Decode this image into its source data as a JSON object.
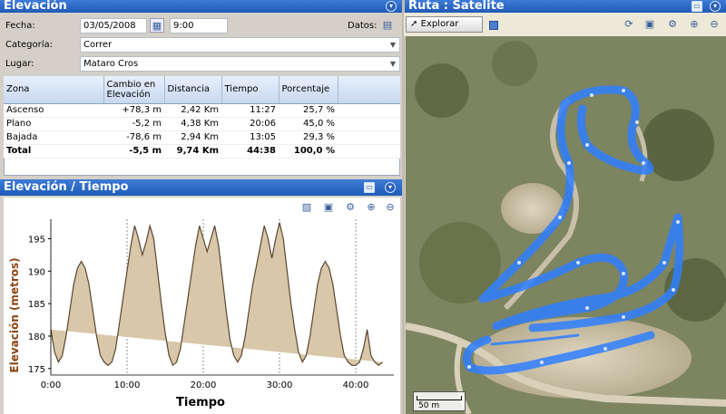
{
  "elevation_panel": {
    "title": "Elevación",
    "fecha_label": "Fecha:",
    "fecha_value": "03/05/2008",
    "hora_value": "9:00",
    "datos_label": "Datos:",
    "categoria_label": "Categoría:",
    "categoria_value": "Correr",
    "lugar_label": "Lugar:",
    "lugar_value": "Mataro Cros"
  },
  "zones_table": {
    "headers": [
      "Zona",
      "Cambio en Elevación",
      "Distancia",
      "Tiempo",
      "Porcentaje"
    ],
    "rows": [
      {
        "zona": "Ascenso",
        "cambio": "+78,3 m",
        "distancia": "2,42 Km",
        "tiempo": "11:27",
        "porcentaje": "25,7 %"
      },
      {
        "zona": "Plano",
        "cambio": "-5,2 m",
        "distancia": "4,38 Km",
        "tiempo": "20:06",
        "porcentaje": "45,0 %"
      },
      {
        "zona": "Bajada",
        "cambio": "-78,6 m",
        "distancia": "2,94 Km",
        "tiempo": "13:05",
        "porcentaje": "29,3 %"
      }
    ],
    "total": {
      "zona": "Total",
      "cambio": "-5,5 m",
      "distancia": "9,74 Km",
      "tiempo": "44:38",
      "porcentaje": "100,0 %"
    }
  },
  "chart_panel": {
    "title": "Elevación / Tiempo"
  },
  "route_panel": {
    "title": "Ruta : Satelite",
    "explore_label": "Explorar",
    "scale_label": "50 m"
  },
  "colors": {
    "title_bar": "#1f5bb8",
    "elevation_fill": "#d8c7a8",
    "elevation_line": "#5a4630",
    "axis_label": "#8b4513",
    "route": "#2f7fff"
  },
  "chart_data": {
    "type": "area",
    "xlabel": "Tiempo",
    "ylabel": "Elevación (metros)",
    "xlim": [
      0,
      45
    ],
    "ylim": [
      174,
      198
    ],
    "x_ticks": [
      "0:00",
      "10:00",
      "20:00",
      "30:00",
      "40:00"
    ],
    "x_tick_values": [
      0,
      10,
      20,
      30,
      40
    ],
    "y_ticks": [
      175,
      180,
      185,
      190,
      195
    ],
    "grid": "vertical-dashed",
    "x": [
      0,
      0.5,
      1,
      1.5,
      2,
      2.5,
      3,
      3.5,
      4,
      4.5,
      5,
      5.5,
      6,
      6.5,
      7,
      7.5,
      8,
      8.5,
      9,
      9.5,
      10,
      10.5,
      11,
      11.5,
      12,
      12.5,
      13,
      13.5,
      14,
      14.5,
      15,
      15.5,
      16,
      16.5,
      17,
      17.5,
      18,
      18.5,
      19,
      19.5,
      20,
      20.5,
      21,
      21.5,
      22,
      22.5,
      23,
      23.5,
      24,
      24.5,
      25,
      25.5,
      26,
      26.5,
      27,
      27.5,
      28,
      28.5,
      29,
      29.5,
      30,
      30.5,
      31,
      31.5,
      32,
      32.5,
      33,
      33.5,
      34,
      34.5,
      35,
      35.5,
      36,
      36.5,
      37,
      37.5,
      38,
      38.5,
      39,
      39.5,
      40,
      40.5,
      41,
      41.5,
      42,
      42.5,
      43,
      43.5,
      44,
      44.5
    ],
    "values": [
      181,
      177.5,
      176,
      177,
      180,
      184,
      188,
      190.5,
      191.5,
      190.5,
      188,
      184,
      180,
      177,
      176,
      175.5,
      176,
      178,
      182,
      186,
      190,
      194,
      197,
      195,
      192.5,
      194.5,
      197,
      195,
      190,
      185,
      180.5,
      177,
      175.5,
      176,
      178,
      182,
      186,
      190,
      194,
      197,
      195,
      193,
      195,
      197,
      194,
      189,
      184,
      179.5,
      177,
      176,
      177,
      180,
      184,
      188,
      191,
      194,
      197,
      195,
      192,
      195,
      197.5,
      195,
      190,
      185,
      181,
      177.5,
      176,
      177,
      180,
      184,
      188,
      190.5,
      191.5,
      190.5,
      188,
      184,
      180,
      177,
      176,
      175.5,
      175.5,
      176,
      178,
      181,
      177,
      176,
      175.5,
      176
    ]
  }
}
